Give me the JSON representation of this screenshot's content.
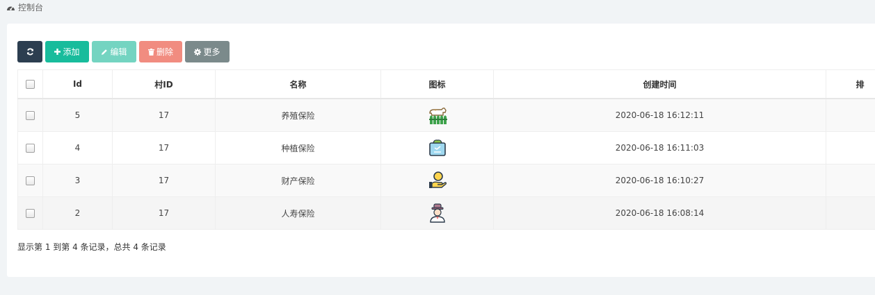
{
  "breadcrumb": {
    "title": "控制台",
    "icon": "dashboard-icon"
  },
  "toolbar": {
    "refresh_icon": "refresh-icon",
    "add_label": "添加",
    "edit_label": "编辑",
    "delete_label": "删除",
    "more_label": "更多"
  },
  "table": {
    "columns": {
      "id": "Id",
      "village_id": "村ID",
      "name": "名称",
      "icon": "图标",
      "created_at": "创建时间",
      "sort_partial": "排"
    },
    "rows": [
      {
        "id": "5",
        "village_id": "17",
        "name": "养殖保险",
        "icon": "livestock-fence-icon",
        "created_at": "2020-06-18 16:12:11"
      },
      {
        "id": "4",
        "village_id": "17",
        "name": "种植保险",
        "icon": "planting-seedling-icon",
        "created_at": "2020-06-18 16:11:03"
      },
      {
        "id": "3",
        "village_id": "17",
        "name": "财产保险",
        "icon": "hand-coin-icon",
        "created_at": "2020-06-18 16:10:27"
      },
      {
        "id": "2",
        "village_id": "17",
        "name": "人寿保险",
        "icon": "person-hat-icon",
        "created_at": "2020-06-18 16:08:14"
      }
    ]
  },
  "pagination": {
    "summary": "显示第 1 到第 4 条记录，总共 4 条记录"
  },
  "colors": {
    "refresh": "#2c3e50",
    "add": "#18bc9c",
    "edit": "#74d4c1",
    "delete": "#f18c80",
    "more": "#7b8a8b"
  }
}
